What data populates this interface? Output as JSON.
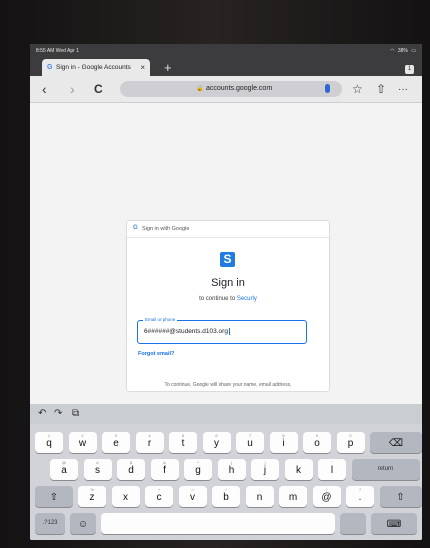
{
  "status": {
    "time": "8:55 AM  Wed Apr 1",
    "wifi": "wifi-icon",
    "battery": "38%"
  },
  "tab": {
    "favicon": "G",
    "title": "Sign in - Google Accounts",
    "close": "×",
    "new_tab": "+",
    "tab_count": "1"
  },
  "toolbar": {
    "back": "‹",
    "forward": "›",
    "reload": "C",
    "lock": "🔒",
    "url": "accounts.google.com",
    "bookmark": "☆",
    "share": "⇧",
    "more": "···"
  },
  "signin": {
    "header_logo": "G",
    "header_text": "Sign in with Google",
    "app_logo": "S",
    "title": "Sign in",
    "subtitle_prefix": "to continue to ",
    "subtitle_link": "Securly",
    "field_label": "Email or phone",
    "field_value": "6######@students.d103.org",
    "forgot": "Forgot email?",
    "notice": "To continue, Google will share your name, email address,"
  },
  "keyboard": {
    "toolbar": {
      "undo": "↶",
      "redo": "↷",
      "paste": "⧉"
    },
    "row1": [
      {
        "ch": "q",
        "hint": "1"
      },
      {
        "ch": "w",
        "hint": "2"
      },
      {
        "ch": "e",
        "hint": "3"
      },
      {
        "ch": "r",
        "hint": "4"
      },
      {
        "ch": "t",
        "hint": "5"
      },
      {
        "ch": "y",
        "hint": "6"
      },
      {
        "ch": "u",
        "hint": "7"
      },
      {
        "ch": "i",
        "hint": "8"
      },
      {
        "ch": "o",
        "hint": "9"
      },
      {
        "ch": "p",
        "hint": "0"
      }
    ],
    "row2": [
      {
        "ch": "a",
        "hint": "@"
      },
      {
        "ch": "s",
        "hint": "#"
      },
      {
        "ch": "d",
        "hint": "$"
      },
      {
        "ch": "f",
        "hint": "&"
      },
      {
        "ch": "g",
        "hint": "*"
      },
      {
        "ch": "h",
        "hint": "("
      },
      {
        "ch": "j",
        "hint": ")"
      },
      {
        "ch": "k",
        "hint": "'"
      },
      {
        "ch": "l",
        "hint": "\""
      }
    ],
    "row3": [
      {
        "ch": "z",
        "hint": "%"
      },
      {
        "ch": "x",
        "hint": "-"
      },
      {
        "ch": "c",
        "hint": "+"
      },
      {
        "ch": "v",
        "hint": "="
      },
      {
        "ch": "b",
        "hint": "/"
      },
      {
        "ch": "n",
        "hint": ";"
      },
      {
        "ch": "m",
        "hint": ":"
      },
      {
        "ch": "@",
        "hint": "!"
      },
      {
        "ch": ".",
        "hint": "?"
      }
    ],
    "backspace": "⌫",
    "return": "return",
    "shift": "⇧",
    "numbers": ".?123",
    "emoji": "☺",
    "hide": "⌨"
  }
}
